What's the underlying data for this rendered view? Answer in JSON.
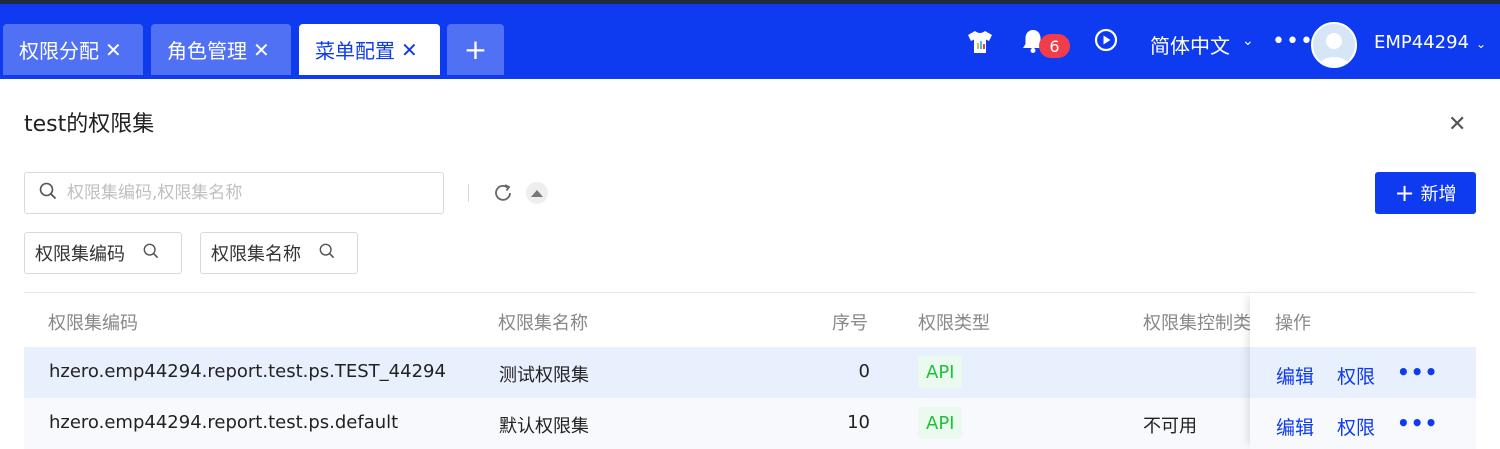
{
  "tabs": [
    {
      "label": "权限分配",
      "close": "✕"
    },
    {
      "label": "角色管理",
      "close": "✕"
    },
    {
      "label": "菜单配置",
      "close": "✕"
    }
  ],
  "tab_add": "+",
  "header": {
    "notification_count": "6",
    "language": "简体中文",
    "username": "EMP44294"
  },
  "page": {
    "title": "test的权限集",
    "close": "✕"
  },
  "search": {
    "placeholder": "权限集编码,权限集名称"
  },
  "toolbar": {
    "new_label": "新增"
  },
  "filters": [
    {
      "label": "权限集编码"
    },
    {
      "label": "权限集名称"
    }
  ],
  "table": {
    "headers": [
      "权限集编码",
      "权限集名称",
      "序号",
      "权限类型",
      "权限集控制类",
      "操作"
    ],
    "rows": [
      {
        "code": "hzero.emp44294.report.test.ps.TEST_44294",
        "name": "测试权限集",
        "order": "0",
        "type": "API",
        "control": "",
        "edit": "编辑",
        "perm": "权限"
      },
      {
        "code": "hzero.emp44294.report.test.ps.default",
        "name": "默认权限集",
        "order": "10",
        "type": "API",
        "control": "不可用",
        "edit": "编辑",
        "perm": "权限"
      }
    ]
  },
  "colors": {
    "brand": "#0f3bf0",
    "tag_green": "#1ec23a",
    "badge_red": "#f03c4b"
  }
}
